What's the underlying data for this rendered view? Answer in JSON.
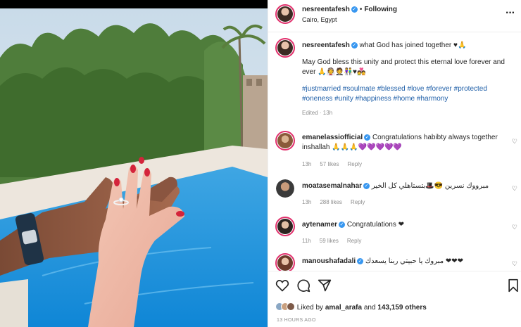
{
  "post": {
    "username": "nesreentafesh",
    "follow_status": "Following",
    "location": "Cairo, Egypt",
    "more_icon": "more-options-icon",
    "caption_line1": "what God has joined together ♥🙏",
    "caption_line2": "May God bless this unity and protect this eternal love forever and ever 🙏👰🤵👫♥💑",
    "hashtags": "#justmarried #soulmate #blessed #love #forever #protected #oneness #unity #happiness #home #harmony",
    "edited": "Edited · 13h"
  },
  "comments": [
    {
      "username": "emanelassiofficial",
      "text": "Congratulations habibty always together inshallah 🙏🙏🙏💜💜💜💜💜",
      "time": "13h",
      "likes": "57 likes",
      "reply": "Reply"
    },
    {
      "username": "moatasemalnahar",
      "text": "مبرووك نسرين 😎🎩بتستاهلي كل الخير",
      "time": "13h",
      "likes": "288 likes",
      "reply": "Reply"
    },
    {
      "username": "aytenamer",
      "text": "Congratulations ❤",
      "time": "11h",
      "likes": "59 likes",
      "reply": "Reply"
    },
    {
      "username": "manoushafadali",
      "text": "مبروك يا حبيتي ربنا يسعدك ❤❤❤"
    }
  ],
  "footer": {
    "liked_prefix": "Liked by",
    "liked_user": "amal_arafa",
    "liked_and": "and",
    "liked_count": "143,159 others",
    "timestamp": "13 HOURS AGO"
  },
  "colors": {
    "link_blue": "#1f5fa8",
    "verified_blue": "#3897f0",
    "story_ring": "#e1306c"
  }
}
